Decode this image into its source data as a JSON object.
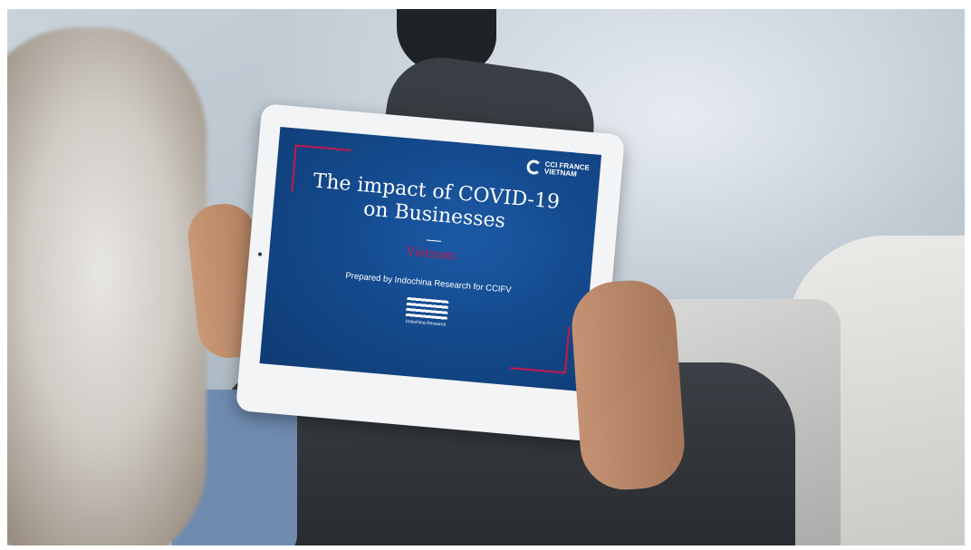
{
  "tablet_slide": {
    "title_line1": "The impact of COVID-19",
    "title_line2": "on Businesses",
    "country": "Vietnam",
    "prepared_by": "Prepared by Indochina Research for CCIFV",
    "org_logo_line1": "CCI FRANCE",
    "org_logo_line2": "VIETNAM",
    "research_logo_text": "Indochina Research",
    "colors": {
      "background": "#144a8d",
      "accent": "#c8184a",
      "text": "#ffffff"
    }
  }
}
